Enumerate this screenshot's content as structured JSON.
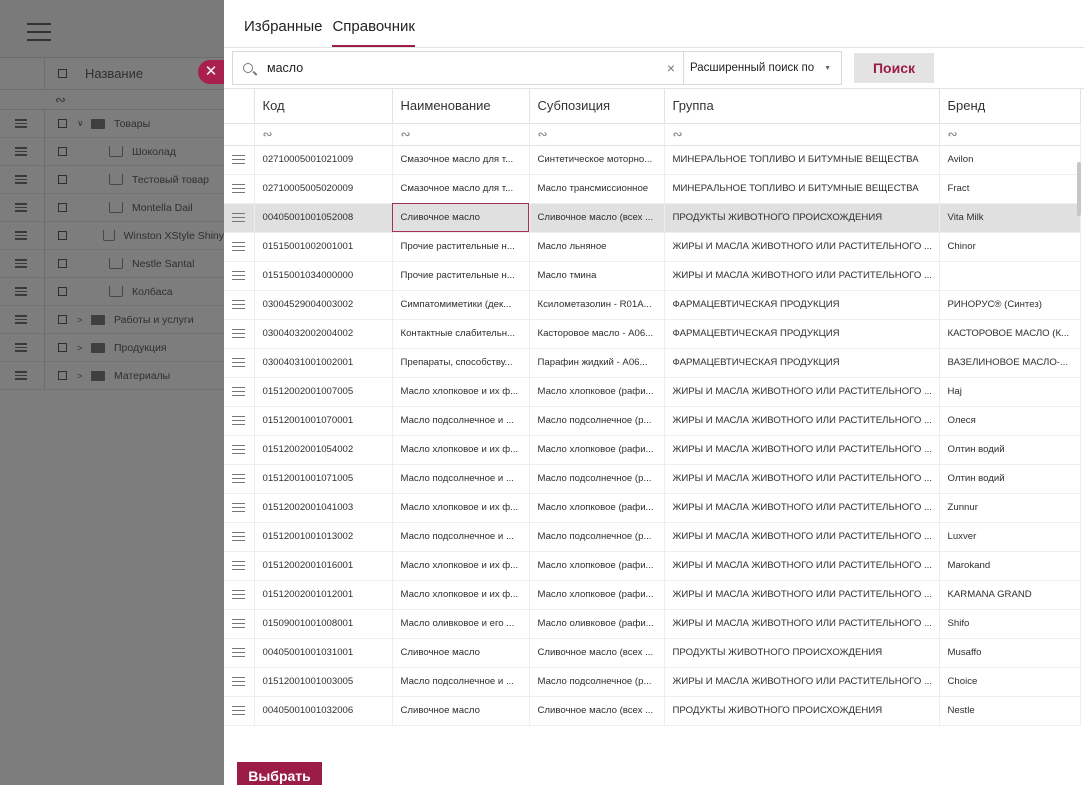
{
  "left": {
    "header_label": "Название",
    "filter_symbol": "∾",
    "tree": [
      {
        "label": "Товары",
        "level": 0,
        "type": "folder-open"
      },
      {
        "label": "Шоколад",
        "level": 1,
        "type": "item"
      },
      {
        "label": "Тестовый товар",
        "level": 1,
        "type": "item"
      },
      {
        "label": "Montella Dail",
        "level": 1,
        "type": "item"
      },
      {
        "label": "Winston XStyle Shiny",
        "level": 1,
        "type": "item"
      },
      {
        "label": "Nestle Santal",
        "level": 1,
        "type": "item"
      },
      {
        "label": "Колбаса",
        "level": 1,
        "type": "item"
      },
      {
        "label": "Работы и услуги",
        "level": 0,
        "type": "folder"
      },
      {
        "label": "Продукция",
        "level": 0,
        "type": "folder"
      },
      {
        "label": "Материалы",
        "level": 0,
        "type": "folder"
      }
    ]
  },
  "tabs": [
    {
      "label": "Избранные",
      "active": false
    },
    {
      "label": "Справочник",
      "active": true
    }
  ],
  "search": {
    "value": "масло",
    "advanced_label": "Расширенный поиск по",
    "button_label": "Поиск"
  },
  "table": {
    "columns": [
      "Код",
      "Наименование",
      "Субпозиция",
      "Группа",
      "Бренд"
    ],
    "filter_symbol": "∾",
    "rows": [
      [
        "02710005001021009",
        "Смазочное масло для т...",
        "Синтетическое моторно...",
        "МИНЕРАЛЬНОЕ ТОПЛИВО И БИТУМНЫЕ ВЕЩЕСТВА",
        "Avilon"
      ],
      [
        "02710005005020009",
        "Смазочное масло для т...",
        "Масло трансмиссионное",
        "МИНЕРАЛЬНОЕ ТОПЛИВО И БИТУМНЫЕ ВЕЩЕСТВА",
        "Fract"
      ],
      [
        "00405001001052008",
        "Сливочное масло",
        "Сливочное масло (всех ...",
        "ПРОДУКТЫ ЖИВОТНОГО ПРОИСХОЖДЕНИЯ",
        "Vita Milk"
      ],
      [
        "01515001002001001",
        "Прочие растительные н...",
        "Масло льняное",
        "ЖИРЫ И МАСЛА ЖИВОТНОГО ИЛИ РАСТИТЕЛЬНОГО ...",
        "Chinor"
      ],
      [
        "01515001034000000",
        "Прочие растительные н...",
        "Масло тмина",
        "ЖИРЫ И МАСЛА ЖИВОТНОГО ИЛИ РАСТИТЕЛЬНОГО ...",
        ""
      ],
      [
        "03004529004003002",
        "Симпатомиметики (дек...",
        "Ксилометазолин - R01A...",
        "ФАРМАЦЕВТИЧЕСКАЯ ПРОДУКЦИЯ",
        "РИНОРУС® (Синтез)"
      ],
      [
        "03004032002004002",
        "Контактные слабительн...",
        "Касторовое масло - A06...",
        "ФАРМАЦЕВТИЧЕСКАЯ ПРОДУКЦИЯ",
        "КАСТОРОВОЕ МАСЛО (К..."
      ],
      [
        "03004031001002001",
        "Препараты, способству...",
        "Парафин жидкий - A06...",
        "ФАРМАЦЕВТИЧЕСКАЯ ПРОДУКЦИЯ",
        "ВАЗЕЛИНОВОЕ МАСЛО-..."
      ],
      [
        "01512002001007005",
        "Масло хлопковое и их ф...",
        "Масло хлопковое (рафи...",
        "ЖИРЫ И МАСЛА ЖИВОТНОГО ИЛИ РАСТИТЕЛЬНОГО ...",
        "Haj"
      ],
      [
        "01512001001070001",
        "Масло подсолнечное и ...",
        "Масло подсолнечное (р...",
        "ЖИРЫ И МАСЛА ЖИВОТНОГО ИЛИ РАСТИТЕЛЬНОГО ...",
        "Олеся"
      ],
      [
        "01512002001054002",
        "Масло хлопковое и их ф...",
        "Масло хлопковое (рафи...",
        "ЖИРЫ И МАСЛА ЖИВОТНОГО ИЛИ РАСТИТЕЛЬНОГО ...",
        "Олтин водий"
      ],
      [
        "01512001001071005",
        "Масло подсолнечное и ...",
        "Масло подсолнечное (р...",
        "ЖИРЫ И МАСЛА ЖИВОТНОГО ИЛИ РАСТИТЕЛЬНОГО ...",
        "Олтин водий"
      ],
      [
        "01512002001041003",
        "Масло хлопковое и их ф...",
        "Масло хлопковое (рафи...",
        "ЖИРЫ И МАСЛА ЖИВОТНОГО ИЛИ РАСТИТЕЛЬНОГО ...",
        "Zunnur"
      ],
      [
        "01512001001013002",
        "Масло подсолнечное и ...",
        "Масло подсолнечное (р...",
        "ЖИРЫ И МАСЛА ЖИВОТНОГО ИЛИ РАСТИТЕЛЬНОГО ...",
        "Luxver"
      ],
      [
        "01512002001016001",
        "Масло хлопковое и их ф...",
        "Масло хлопковое (рафи...",
        "ЖИРЫ И МАСЛА ЖИВОТНОГО ИЛИ РАСТИТЕЛЬНОГО ...",
        "Marokand"
      ],
      [
        "01512002001012001",
        "Масло хлопковое и их ф...",
        "Масло хлопковое (рафи...",
        "ЖИРЫ И МАСЛА ЖИВОТНОГО ИЛИ РАСТИТЕЛЬНОГО ...",
        "KARMANA GRAND"
      ],
      [
        "01509001001008001",
        "Масло оливковое и его ...",
        "Масло оливковое (рафи...",
        "ЖИРЫ И МАСЛА ЖИВОТНОГО ИЛИ РАСТИТЕЛЬНОГО ...",
        "Shifo"
      ],
      [
        "00405001001031001",
        "Сливочное масло",
        "Сливочное масло (всех ...",
        "ПРОДУКТЫ ЖИВОТНОГО ПРОИСХОЖДЕНИЯ",
        "Musaffo"
      ],
      [
        "01512001001003005",
        "Масло подсолнечное и ...",
        "Масло подсолнечное (р...",
        "ЖИРЫ И МАСЛА ЖИВОТНОГО ИЛИ РАСТИТЕЛЬНОГО ...",
        "Choice"
      ],
      [
        "00405001001032006",
        "Сливочное масло",
        "Сливочное масло (всех ...",
        "ПРОДУКТЫ ЖИВОТНОГО ПРОИСХОЖДЕНИЯ",
        "Nestle"
      ]
    ],
    "selected_row": 2
  },
  "footer": {
    "select_label": "Выбрать"
  },
  "colors": {
    "accent": "#9c1c48",
    "overlay": "#7d7d7d",
    "selected_row": "#e0e0e0"
  }
}
